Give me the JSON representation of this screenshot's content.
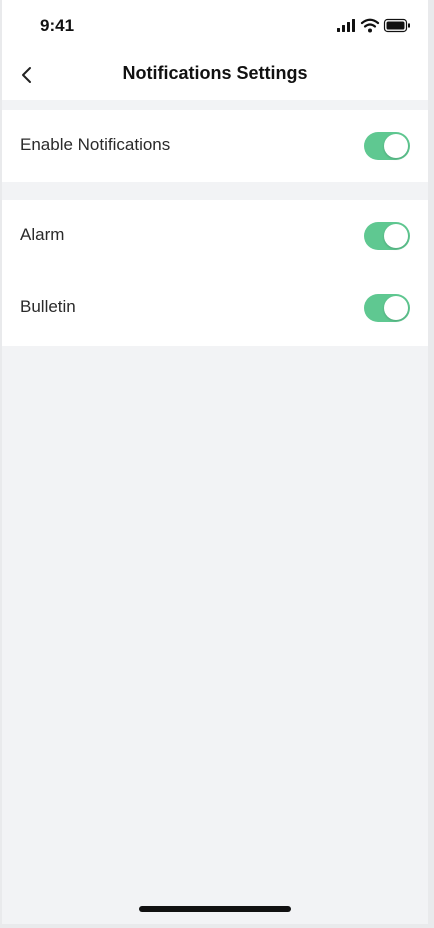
{
  "status_bar": {
    "time": "9:41",
    "icons": [
      "cellular-signal-icon",
      "wifi-icon",
      "battery-icon"
    ]
  },
  "nav": {
    "title": "Notifications Settings",
    "back_icon": "chevron-left-icon"
  },
  "settings": {
    "enable_notifications": {
      "label": "Enable Notifications",
      "on": true
    },
    "alarm": {
      "label": "Alarm",
      "on": true
    },
    "bulletin": {
      "label": "Bulletin",
      "on": true
    }
  },
  "colors": {
    "toggle_on": "#5fc891",
    "page_background": "#f2f3f5",
    "card_background": "#ffffff"
  }
}
